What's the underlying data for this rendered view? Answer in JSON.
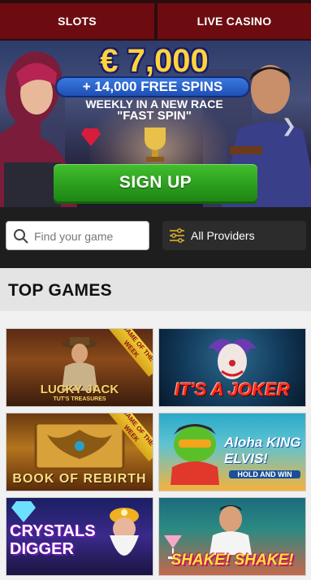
{
  "nav": {
    "tabs": [
      {
        "label": "SLOTS"
      },
      {
        "label": "LIVE CASINO"
      }
    ]
  },
  "hero": {
    "amount": "€ 7,000",
    "free_spins": "+ 14,000 FREE SPINS",
    "line1": "WEEKLY IN A NEW RACE",
    "line2": "\"FAST SPIN\"",
    "cta_label": "SIGN UP",
    "next_icon": "chevron-right-icon"
  },
  "search": {
    "placeholder": "Find your game",
    "icon": "search-icon"
  },
  "providers": {
    "label": "All Providers",
    "icon": "filter-sliders-icon"
  },
  "section": {
    "title": "TOP GAMES"
  },
  "games": [
    {
      "title": "LUCKY JACK",
      "subtitle": "TUT'S TREASURES",
      "badge": "GAME OF THE WEEK"
    },
    {
      "title": "IT'S A JOKER"
    },
    {
      "title": "BOOK OF REBIRTH",
      "badge": "GAME OF THE WEEK"
    },
    {
      "title": "Aloha KING ELVIS!",
      "subtitle": "HOLD AND WIN"
    },
    {
      "title": "CRYSTALS DIGGER"
    },
    {
      "title": "SHAKE! SHAKE!"
    }
  ],
  "colors": {
    "nav_tab": "#6d0c10",
    "cta_green": "#2a9c1d",
    "gold": "#ffd43b",
    "spins_blue": "#1f4fb4"
  }
}
